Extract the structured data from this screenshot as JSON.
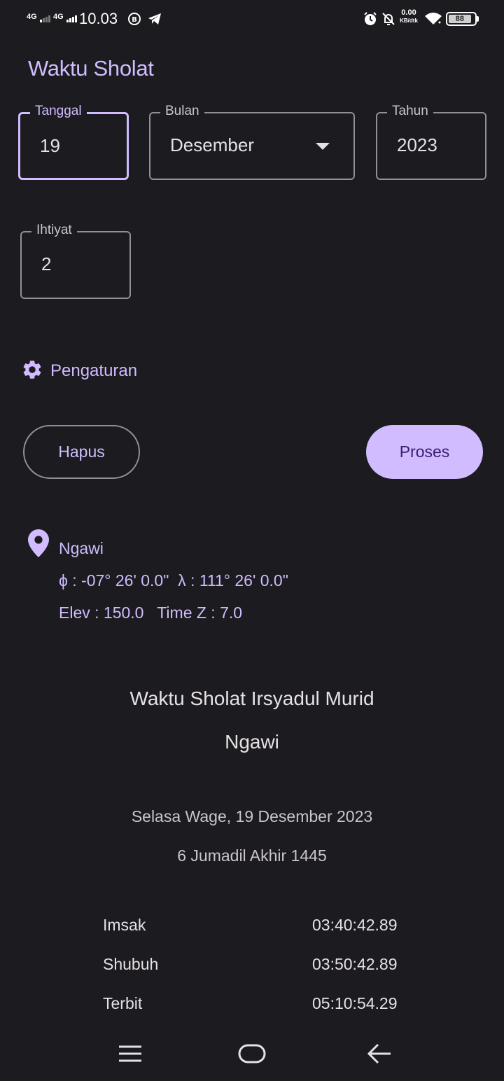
{
  "status_bar": {
    "signal1": "4G",
    "signal2": "4G",
    "time": "10.03",
    "net_speed_value": "0.00",
    "net_speed_unit": "KB/dtk",
    "battery": "88"
  },
  "app": {
    "title": "Waktu Sholat"
  },
  "form": {
    "tanggal": {
      "label": "Tanggal",
      "value": "19"
    },
    "bulan": {
      "label": "Bulan",
      "value": "Desember"
    },
    "tahun": {
      "label": "Tahun",
      "value": "2023"
    },
    "ihtiyat": {
      "label": "Ihtiyat",
      "value": "2"
    }
  },
  "settings_label": "Pengaturan",
  "buttons": {
    "clear": "Hapus",
    "process": "Proses"
  },
  "location": {
    "name": "Ngawi",
    "coords": "ϕ : -07° 26' 0.0\"  λ : 111° 26' 0.0\"",
    "elev_tz": "Elev : 150.0   Time Z : 7.0"
  },
  "result": {
    "title": "Waktu Sholat Irsyadul Murid",
    "city": "Ngawi",
    "date_masehi": "Selasa Wage, 19 Desember 2023",
    "date_hijri": "6 Jumadil Akhir 1445",
    "times": [
      {
        "name": "Imsak",
        "time": "03:40:42.89"
      },
      {
        "name": "Shubuh",
        "time": "03:50:42.89"
      },
      {
        "name": "Terbit",
        "time": "05:10:54.29"
      }
    ]
  },
  "icons": {
    "settings": "gear-icon",
    "location": "location-pin-icon",
    "nav_menu": "menu-icon",
    "nav_home": "home-icon",
    "nav_back": "back-arrow-icon"
  },
  "colors": {
    "background": "#1c1b1f",
    "primary": "#d0bcff",
    "on_primary": "#381e72",
    "outline": "#938f99"
  }
}
